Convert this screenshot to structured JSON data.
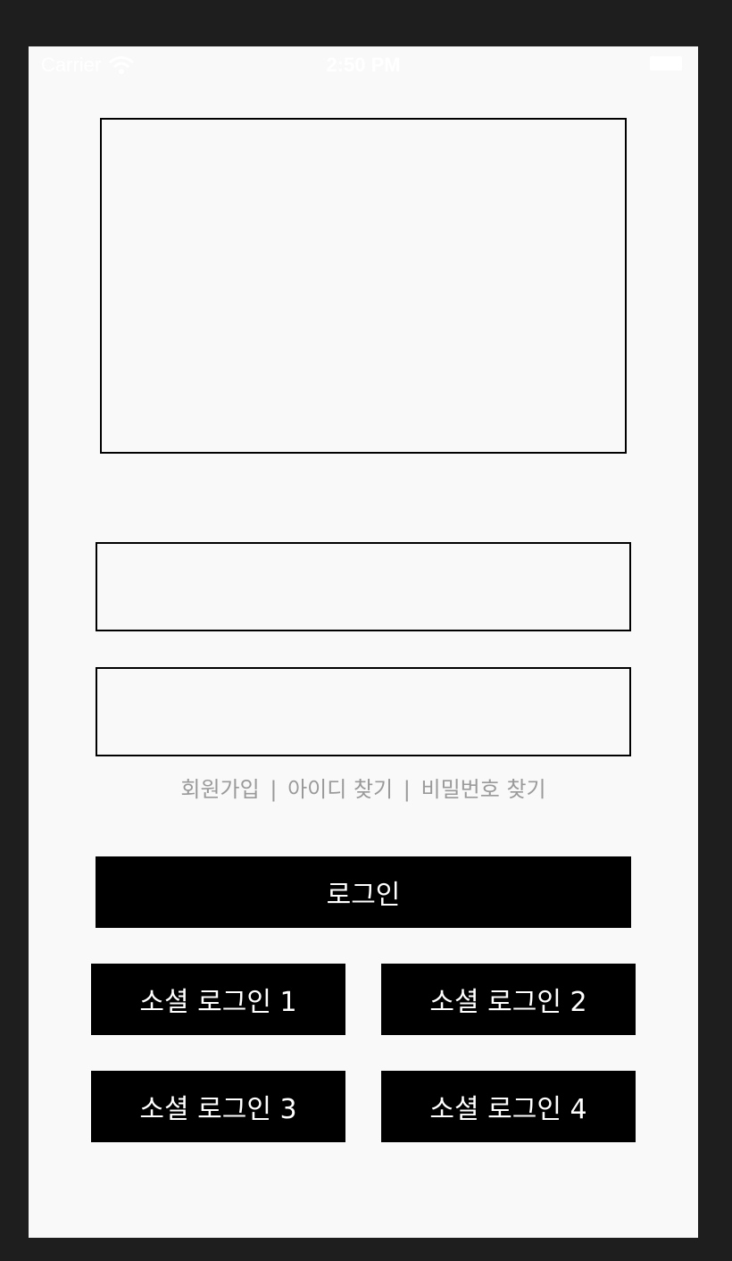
{
  "status_bar": {
    "carrier": "Carrier",
    "time": "2:50 PM",
    "wifi_icon": "wifi-icon",
    "battery_icon": "battery-icon"
  },
  "logo": {
    "icon": "image-placeholder"
  },
  "form": {
    "id_field": {
      "value": "",
      "placeholder": ""
    },
    "password_field": {
      "value": "",
      "placeholder": ""
    }
  },
  "links": {
    "signup": "회원가입",
    "find_id": "아이디 찾기",
    "find_password": "비밀번호 찾기",
    "separator": "|"
  },
  "login_button": "로그인",
  "social_buttons": [
    "소셜 로그인 1",
    "소셜 로그인 2",
    "소셜 로그인 3",
    "소셜 로그인 4"
  ],
  "colors": {
    "background": "#f9f9f9",
    "frame": "#1e1e1e",
    "button": "#000000",
    "button_text": "#ffffff",
    "link_text": "#9a9a9a"
  }
}
